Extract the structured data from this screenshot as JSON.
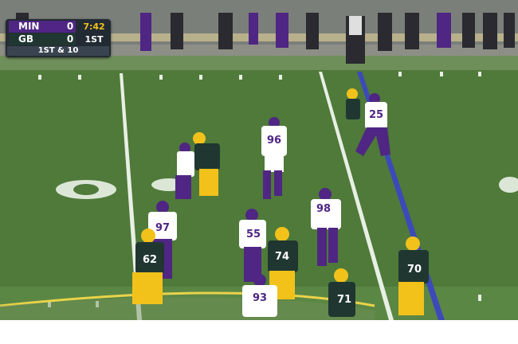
{
  "scorebug": {
    "away_team": "MIN",
    "away_score": "0",
    "home_team": "GB",
    "home_score": "0",
    "clock": "7:42",
    "quarter": "1ST",
    "down_distance": "1ST & 10"
  },
  "players": [
    {
      "number": "96",
      "team": "MIN"
    },
    {
      "number": "25",
      "team": "MIN"
    },
    {
      "number": "97",
      "team": "MIN"
    },
    {
      "number": "55",
      "team": "MIN"
    },
    {
      "number": "98",
      "team": "MIN"
    },
    {
      "number": "93",
      "team": "MIN"
    },
    {
      "number": "74",
      "team": "GB"
    },
    {
      "number": "70",
      "team": "GB"
    },
    {
      "number": "62",
      "team": "GB"
    },
    {
      "number": "71",
      "team": "GB"
    }
  ],
  "colors": {
    "vikings_purple": "#4f2683",
    "packers_green": "#203731",
    "packers_gold": "#f2c21b",
    "field_green": "#4f7a3a",
    "clock_yellow": "#f0c020"
  }
}
